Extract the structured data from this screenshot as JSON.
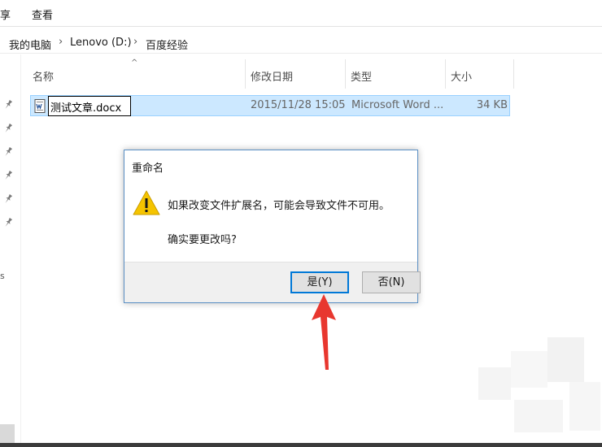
{
  "menubar": {
    "share": "享",
    "view": "查看"
  },
  "breadcrumb": {
    "pc": "我的电脑",
    "drive": "Lenovo (D:)",
    "folder": "百度经验",
    "separator": "›"
  },
  "navpane": {
    "partial_label": "s"
  },
  "columns": {
    "name": "名称",
    "date": "修改日期",
    "type": "类型",
    "size": "大小",
    "sort_glyph": "^"
  },
  "file": {
    "rename_value": "测试文章.docx",
    "modified": "2015/11/28 15:05",
    "type": "Microsoft Word ...",
    "size": "34 KB"
  },
  "dialog": {
    "title": "重命名",
    "message": "如果改变文件扩展名，可能会导致文件不可用。",
    "question": "确实要更改吗?",
    "yes_label": "是(Y)",
    "no_label": "否(N)"
  },
  "colors": {
    "selection": "#cce8ff",
    "selection_border": "#99d1ff",
    "accent": "#0078d7",
    "arrow": "#e8372f",
    "warning": "#f5c400"
  },
  "icons": {
    "pin": "pin-icon",
    "file": "word-document-icon",
    "warning": "warning-icon"
  }
}
